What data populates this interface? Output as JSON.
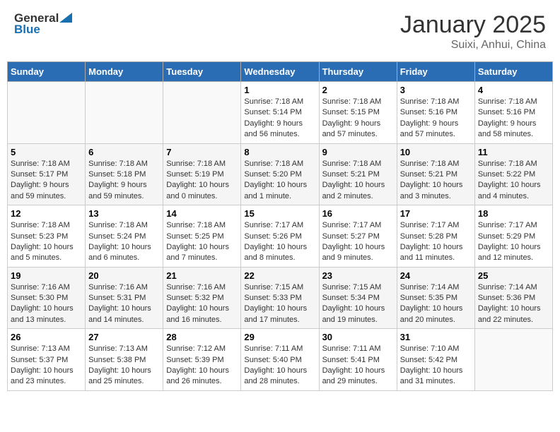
{
  "header": {
    "logo_general": "General",
    "logo_blue": "Blue",
    "title": "January 2025",
    "subtitle": "Suixi, Anhui, China"
  },
  "days_of_week": [
    "Sunday",
    "Monday",
    "Tuesday",
    "Wednesday",
    "Thursday",
    "Friday",
    "Saturday"
  ],
  "weeks": [
    [
      {
        "day": "",
        "info": ""
      },
      {
        "day": "",
        "info": ""
      },
      {
        "day": "",
        "info": ""
      },
      {
        "day": "1",
        "info": "Sunrise: 7:18 AM\nSunset: 5:14 PM\nDaylight: 9 hours and 56 minutes."
      },
      {
        "day": "2",
        "info": "Sunrise: 7:18 AM\nSunset: 5:15 PM\nDaylight: 9 hours and 57 minutes."
      },
      {
        "day": "3",
        "info": "Sunrise: 7:18 AM\nSunset: 5:16 PM\nDaylight: 9 hours and 57 minutes."
      },
      {
        "day": "4",
        "info": "Sunrise: 7:18 AM\nSunset: 5:16 PM\nDaylight: 9 hours and 58 minutes."
      }
    ],
    [
      {
        "day": "5",
        "info": "Sunrise: 7:18 AM\nSunset: 5:17 PM\nDaylight: 9 hours and 59 minutes."
      },
      {
        "day": "6",
        "info": "Sunrise: 7:18 AM\nSunset: 5:18 PM\nDaylight: 9 hours and 59 minutes."
      },
      {
        "day": "7",
        "info": "Sunrise: 7:18 AM\nSunset: 5:19 PM\nDaylight: 10 hours and 0 minutes."
      },
      {
        "day": "8",
        "info": "Sunrise: 7:18 AM\nSunset: 5:20 PM\nDaylight: 10 hours and 1 minute."
      },
      {
        "day": "9",
        "info": "Sunrise: 7:18 AM\nSunset: 5:21 PM\nDaylight: 10 hours and 2 minutes."
      },
      {
        "day": "10",
        "info": "Sunrise: 7:18 AM\nSunset: 5:21 PM\nDaylight: 10 hours and 3 minutes."
      },
      {
        "day": "11",
        "info": "Sunrise: 7:18 AM\nSunset: 5:22 PM\nDaylight: 10 hours and 4 minutes."
      }
    ],
    [
      {
        "day": "12",
        "info": "Sunrise: 7:18 AM\nSunset: 5:23 PM\nDaylight: 10 hours and 5 minutes."
      },
      {
        "day": "13",
        "info": "Sunrise: 7:18 AM\nSunset: 5:24 PM\nDaylight: 10 hours and 6 minutes."
      },
      {
        "day": "14",
        "info": "Sunrise: 7:18 AM\nSunset: 5:25 PM\nDaylight: 10 hours and 7 minutes."
      },
      {
        "day": "15",
        "info": "Sunrise: 7:17 AM\nSunset: 5:26 PM\nDaylight: 10 hours and 8 minutes."
      },
      {
        "day": "16",
        "info": "Sunrise: 7:17 AM\nSunset: 5:27 PM\nDaylight: 10 hours and 9 minutes."
      },
      {
        "day": "17",
        "info": "Sunrise: 7:17 AM\nSunset: 5:28 PM\nDaylight: 10 hours and 11 minutes."
      },
      {
        "day": "18",
        "info": "Sunrise: 7:17 AM\nSunset: 5:29 PM\nDaylight: 10 hours and 12 minutes."
      }
    ],
    [
      {
        "day": "19",
        "info": "Sunrise: 7:16 AM\nSunset: 5:30 PM\nDaylight: 10 hours and 13 minutes."
      },
      {
        "day": "20",
        "info": "Sunrise: 7:16 AM\nSunset: 5:31 PM\nDaylight: 10 hours and 14 minutes."
      },
      {
        "day": "21",
        "info": "Sunrise: 7:16 AM\nSunset: 5:32 PM\nDaylight: 10 hours and 16 minutes."
      },
      {
        "day": "22",
        "info": "Sunrise: 7:15 AM\nSunset: 5:33 PM\nDaylight: 10 hours and 17 minutes."
      },
      {
        "day": "23",
        "info": "Sunrise: 7:15 AM\nSunset: 5:34 PM\nDaylight: 10 hours and 19 minutes."
      },
      {
        "day": "24",
        "info": "Sunrise: 7:14 AM\nSunset: 5:35 PM\nDaylight: 10 hours and 20 minutes."
      },
      {
        "day": "25",
        "info": "Sunrise: 7:14 AM\nSunset: 5:36 PM\nDaylight: 10 hours and 22 minutes."
      }
    ],
    [
      {
        "day": "26",
        "info": "Sunrise: 7:13 AM\nSunset: 5:37 PM\nDaylight: 10 hours and 23 minutes."
      },
      {
        "day": "27",
        "info": "Sunrise: 7:13 AM\nSunset: 5:38 PM\nDaylight: 10 hours and 25 minutes."
      },
      {
        "day": "28",
        "info": "Sunrise: 7:12 AM\nSunset: 5:39 PM\nDaylight: 10 hours and 26 minutes."
      },
      {
        "day": "29",
        "info": "Sunrise: 7:11 AM\nSunset: 5:40 PM\nDaylight: 10 hours and 28 minutes."
      },
      {
        "day": "30",
        "info": "Sunrise: 7:11 AM\nSunset: 5:41 PM\nDaylight: 10 hours and 29 minutes."
      },
      {
        "day": "31",
        "info": "Sunrise: 7:10 AM\nSunset: 5:42 PM\nDaylight: 10 hours and 31 minutes."
      },
      {
        "day": "",
        "info": ""
      }
    ]
  ]
}
